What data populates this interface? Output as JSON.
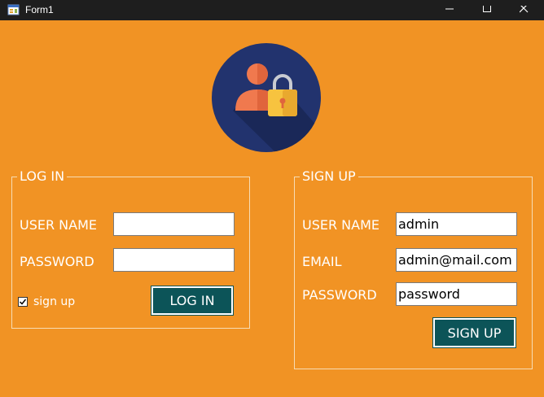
{
  "window": {
    "title": "Form1",
    "app_icon": "form-icon",
    "controls": [
      "minimize-icon",
      "maximize-icon",
      "close-icon"
    ]
  },
  "avatar": {
    "icon": "user-lock-icon"
  },
  "login": {
    "legend": "LOG IN",
    "username_label": "USER NAME",
    "username_value": "",
    "password_label": "PASSWORD",
    "password_value": "",
    "signup_checkbox_label": "sign up",
    "signup_checked": true,
    "button_label": "LOG IN"
  },
  "signup": {
    "legend": "SIGN UP",
    "username_label": "USER NAME",
    "username_value": "admin",
    "email_label": "EMAIL",
    "email_value": "admin@mail.com",
    "password_label": "PASSWORD",
    "password_value": "password",
    "button_label": "SIGN UP"
  },
  "colors": {
    "form_background": "#f19324",
    "titlebar": "#1e1e1e",
    "button": "#0c5458",
    "avatar_circle": "#22336e",
    "person": "#f0794e",
    "lock": "#f7c33f"
  }
}
